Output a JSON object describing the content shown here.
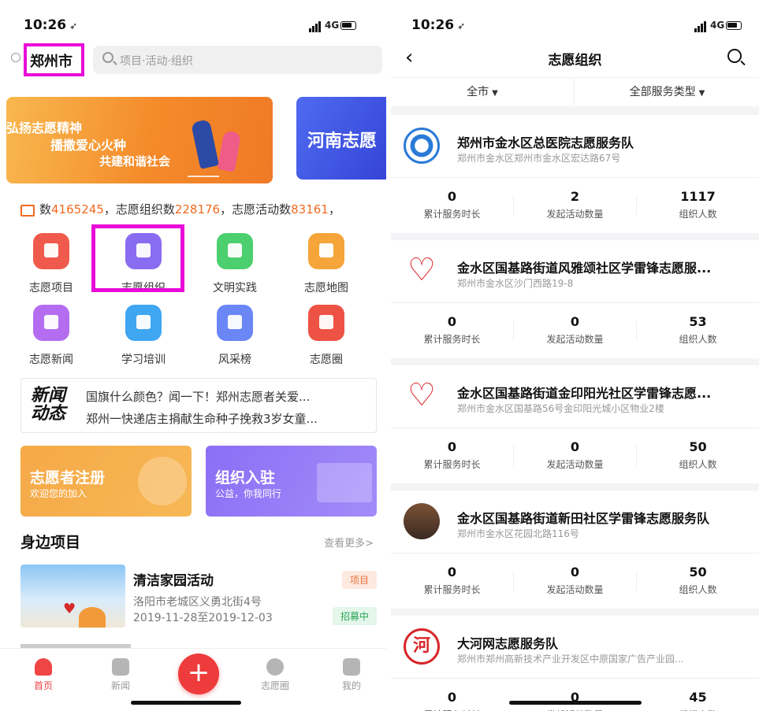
{
  "status": {
    "time": "10:26",
    "network": "4G"
  },
  "left": {
    "city": "郑州市",
    "search_placeholder": "项目·活动·组织",
    "banner1": {
      "line1": "弘扬志愿精神",
      "line2": "播撒爱心火种",
      "line3": "共建和谐社会"
    },
    "banner2": {
      "text": "河南志愿"
    },
    "stats": {
      "prefix": "数",
      "v1": "4165245",
      "mid1": "，志愿组织数",
      "v2": "228176",
      "mid2": "，志愿活动数",
      "v3": "83161",
      "suffix": "，"
    },
    "grid": [
      {
        "label": "志愿项目",
        "color": "#ef5a4c",
        "icon": "bookmark-icon"
      },
      {
        "label": "志愿组织",
        "color": "#8a6cf0",
        "icon": "building-icon"
      },
      {
        "label": "文明实践",
        "color": "#4ccf6e",
        "icon": "flag-icon"
      },
      {
        "label": "志愿地图",
        "color": "#f5a53a",
        "icon": "map-pin-icon"
      },
      {
        "label": "志愿新闻",
        "color": "#b46df0",
        "icon": "news-icon"
      },
      {
        "label": "学习培训",
        "color": "#3fa6f2",
        "icon": "graduation-cap-icon"
      },
      {
        "label": "风采榜",
        "color": "#6b86f5",
        "icon": "shield-check-icon"
      },
      {
        "label": "志愿圈",
        "color": "#ee5244",
        "icon": "target-icon"
      }
    ],
    "news": {
      "logo": "新闻动态",
      "items": [
        "国旗什么颜色？闻一下！郑州志愿者关爱...",
        "郑州一快递店主捐献生命种子挽救3岁女童..."
      ]
    },
    "cards": [
      {
        "title": "志愿者注册",
        "sub": "欢迎您的加入"
      },
      {
        "title": "组织入驻",
        "sub": "公益，你我同行"
      }
    ],
    "section": {
      "title": "身边项目",
      "more": "查看更多>"
    },
    "project": {
      "name": "清洁家园活动",
      "address": "洛阳市老城区义勇北街4号",
      "date": "2019-11-28至2019-12-03",
      "tag_type": "项目",
      "tag_status": "招募中"
    },
    "tabs": [
      {
        "label": "首页",
        "icon": "home-icon"
      },
      {
        "label": "新闻",
        "icon": "news-icon"
      },
      {
        "label": "志愿圈",
        "icon": "eye-icon"
      },
      {
        "label": "我的",
        "icon": "user-icon"
      }
    ]
  },
  "right": {
    "title": "志愿组织",
    "filters": [
      "全市",
      "全部服务类型"
    ],
    "stat_labels": [
      "累计服务时长",
      "发起活动数量",
      "组织人数"
    ],
    "orgs": [
      {
        "name": "郑州市金水区总医院志愿服务队",
        "address": "郑州市金水区郑州市金水区宏达路67号",
        "hours": "0",
        "activities": "2",
        "members": "1117",
        "logo": "hospital-logo-icon"
      },
      {
        "name": "金水区国基路街道风雅颂社区学雷锋志愿服...",
        "address": "郑州市金水区沙门西路19-8",
        "hours": "0",
        "activities": "0",
        "members": "53",
        "logo": "heart-hand-icon"
      },
      {
        "name": "金水区国基路街道金印阳光社区学雷锋志愿...",
        "address": "郑州市金水区国基路56号金印阳光城小区物业2楼",
        "hours": "0",
        "activities": "0",
        "members": "50",
        "logo": "heart-hand-icon"
      },
      {
        "name": "金水区国基路街道新田社区学雷锋志愿服务队",
        "address": "郑州市金水区花园北路116号",
        "hours": "0",
        "activities": "0",
        "members": "50",
        "logo": "building-photo-icon"
      },
      {
        "name": "大河网志愿服务队",
        "address": "郑州市郑州高新技术产业开发区中原国家广告产业园...",
        "hours": "0",
        "activities": "0",
        "members": "45",
        "logo": "dahe-seal-icon"
      }
    ]
  }
}
